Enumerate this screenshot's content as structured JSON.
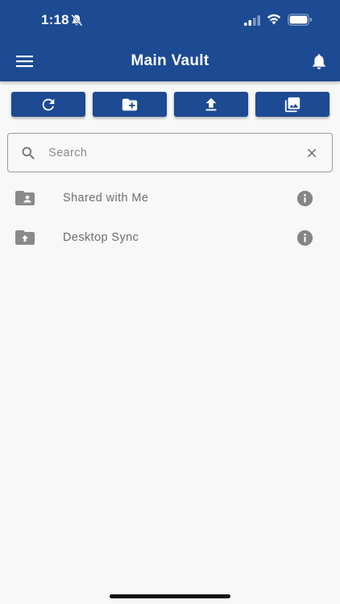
{
  "status_bar": {
    "time": "1:18"
  },
  "header": {
    "title": "Main Vault",
    "menu_icon": "hamburger-menu-icon",
    "notification_icon": "bell-icon",
    "background_color": "#1c4a93"
  },
  "toolbar": {
    "buttons": [
      {
        "name": "refresh",
        "icon": "refresh-icon"
      },
      {
        "name": "new-folder",
        "icon": "folder-plus-icon"
      },
      {
        "name": "upload",
        "icon": "upload-icon"
      },
      {
        "name": "gallery",
        "icon": "photo-library-icon"
      }
    ]
  },
  "search": {
    "placeholder": "Search",
    "value": ""
  },
  "folders": [
    {
      "label": "Shared with Me",
      "icon": "shared-folder-icon"
    },
    {
      "label": "Desktop Sync",
      "icon": "sync-folder-icon"
    }
  ]
}
